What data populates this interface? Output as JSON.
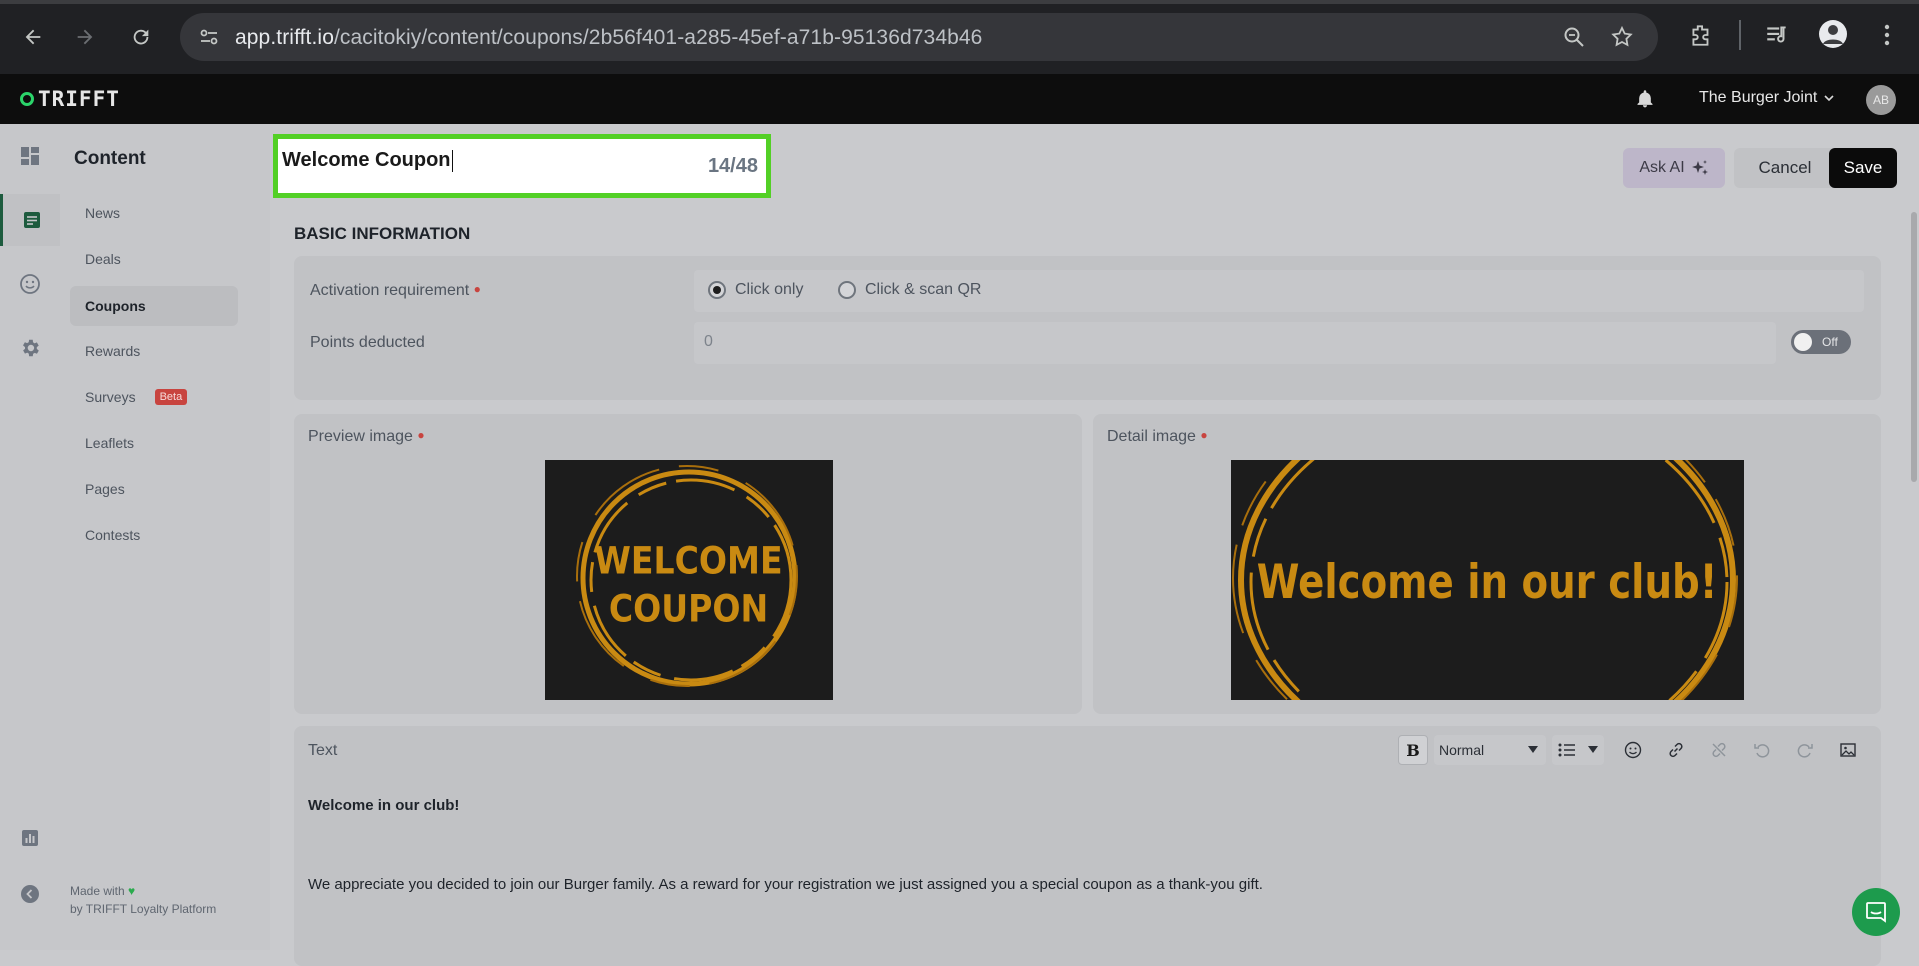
{
  "browser": {
    "url_host": "app.trifft.io",
    "url_path": "/cacitokiy/content/coupons/2b56f401-a285-45ef-a71b-95136d734b46"
  },
  "header": {
    "logo": "TRIFFT",
    "tenant": "The Burger Joint",
    "avatar_initials": "AB"
  },
  "sidebar": {
    "title": "Content",
    "items": [
      {
        "label": "News"
      },
      {
        "label": "Deals"
      },
      {
        "label": "Coupons",
        "active": true
      },
      {
        "label": "Rewards"
      },
      {
        "label": "Surveys",
        "badge": "Beta"
      },
      {
        "label": "Leaflets"
      },
      {
        "label": "Pages"
      },
      {
        "label": "Contests"
      }
    ],
    "made_with_prefix": "Made with",
    "made_with_by": "by TRIFFT Loyalty Platform"
  },
  "editor": {
    "title_value": "Welcome Coupon",
    "title_counter": "14/48",
    "ask_ai_label": "Ask AI",
    "cancel_label": "Cancel",
    "save_label": "Save"
  },
  "basic": {
    "heading": "BASIC INFORMATION",
    "activation_label": "Activation requirement",
    "activation_options": [
      "Click only",
      "Click & scan QR"
    ],
    "activation_selected": "Click only",
    "points_label": "Points deducted",
    "points_value": "0",
    "toggle_label": "Off"
  },
  "images": {
    "preview_label": "Preview image",
    "preview_text_1": "WELCOME",
    "preview_text_2": "COUPON",
    "detail_label": "Detail image",
    "detail_text": "Welcome in our club!"
  },
  "text_section": {
    "label": "Text",
    "format_value": "Normal",
    "heading_line": "Welcome in our club!",
    "body_line": "We appreciate you decided to join our Burger family. As a reward for your registration we just assigned you a special coupon as a thank-you gift."
  },
  "colors": {
    "accent_green": "#53d026",
    "brand_green": "#2bd46a",
    "coupon_orange": "#c98a12",
    "required_red": "#c8443f"
  }
}
